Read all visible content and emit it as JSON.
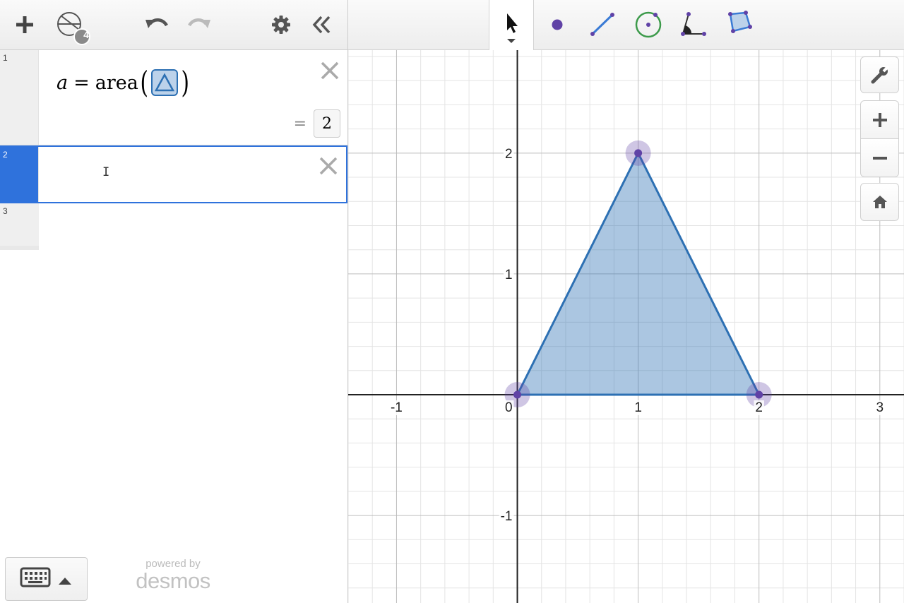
{
  "expressions": [
    {
      "index": "1",
      "lhs": "a",
      "eq": "=",
      "func": "area",
      "result_eq": "=",
      "result": "2"
    },
    {
      "index": "2"
    },
    {
      "index": "3"
    }
  ],
  "toolbar": {
    "badge_count": "4"
  },
  "footer": {
    "powered_by": "powered by",
    "brand": "desmos"
  },
  "graph": {
    "x_ticks": [
      "-1",
      "0",
      "1",
      "2",
      "3"
    ],
    "y_ticks": [
      "2",
      "1",
      "-1"
    ],
    "triangle": [
      [
        0,
        0
      ],
      [
        1,
        2
      ],
      [
        2,
        0
      ]
    ],
    "x_range": [
      -1.4,
      3.2
    ],
    "colors": {
      "polygon_stroke": "#2d70b3",
      "polygon_fill": "#2d70b3",
      "point": "#6042a6",
      "accent": "#2f72dc"
    }
  },
  "icons": {
    "add": "plus-icon",
    "geometry": "geometry-icon",
    "undo": "undo-icon",
    "redo": "redo-icon",
    "settings": "gear-icon",
    "collapse": "double-chevron-left-icon",
    "pointer": "pointer-icon",
    "point": "point-tool-icon",
    "segment": "segment-tool-icon",
    "circle": "circle-tool-icon",
    "angle": "angle-tool-icon",
    "polygon": "polygon-tool-icon",
    "wrench": "wrench-icon",
    "zoom_in": "plus-icon",
    "zoom_out": "minus-icon",
    "home": "home-icon",
    "keyboard": "keyboard-icon"
  }
}
